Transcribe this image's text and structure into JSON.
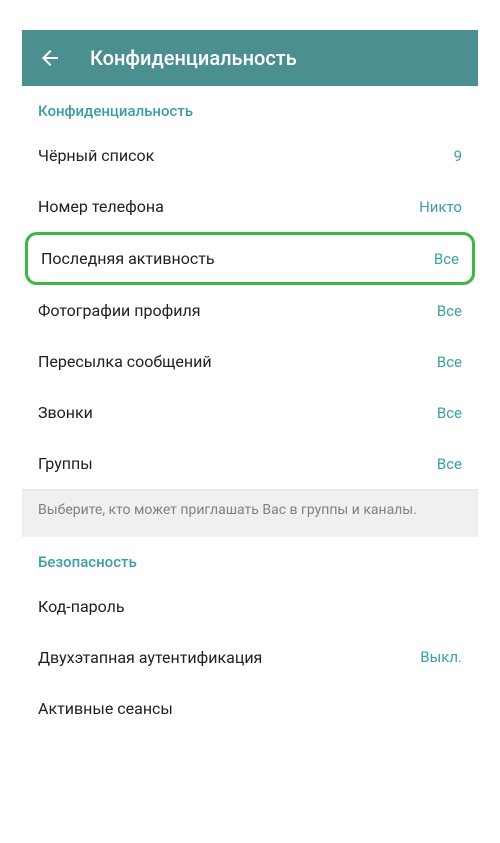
{
  "header": {
    "title": "Конфиденциальность"
  },
  "privacy_section": {
    "title": "Конфиденциальность",
    "items": [
      {
        "label": "Чёрный список",
        "value": "9"
      },
      {
        "label": "Номер телефона",
        "value": "Никто"
      },
      {
        "label": "Последняя активность",
        "value": "Все"
      },
      {
        "label": "Фотографии профиля",
        "value": "Все"
      },
      {
        "label": "Пересылка сообщений",
        "value": "Все"
      },
      {
        "label": "Звонки",
        "value": "Все"
      },
      {
        "label": "Группы",
        "value": "Все"
      }
    ],
    "hint": "Выберите, кто может приглашать Вас в группы и каналы."
  },
  "security_section": {
    "title": "Безопасность",
    "items": [
      {
        "label": "Код-пароль",
        "value": ""
      },
      {
        "label": "Двухэтапная аутентификация",
        "value": "Выкл."
      },
      {
        "label": "Активные сеансы",
        "value": ""
      }
    ]
  }
}
